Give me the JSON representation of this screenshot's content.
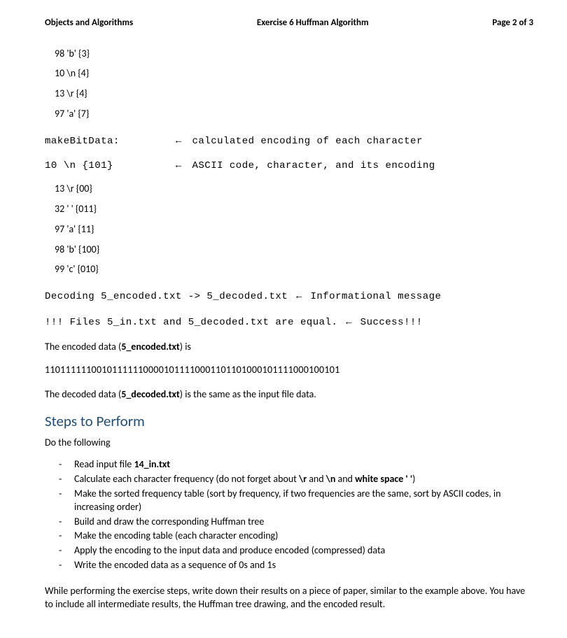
{
  "header": {
    "left": "Objects and Algorithms",
    "center": "Exercise 6 Huffman Algorithm",
    "right": "Page 2 of 3"
  },
  "freq": {
    "l1": "98 'b' {3}",
    "l2": "10 \\n {4}",
    "l3": "13 \\r {4}",
    "l4": "97 'a' {7}"
  },
  "makebit": {
    "label": "makeBitData:",
    "arrow": "←",
    "note": "calculated encoding of each character"
  },
  "encrow": {
    "left": "10 \\n {101}",
    "arrow": "←",
    "note": "ASCII code, character, and its encoding"
  },
  "enc": {
    "l1": "13 \\r {00}",
    "l2": "32 ' ' {011}",
    "l3": "97 'a' {11}",
    "l4": "98 'b' {100}",
    "l5": "99 'c' {010}"
  },
  "decode_line": {
    "text": "Decoding 5_encoded.txt -> 5_decoded.txt ",
    "arrow": "←",
    "note": " Informational message"
  },
  "equal_line": {
    "text": "!!! Files 5_in.txt and 5_decoded.txt are equal. ",
    "arrow": "←",
    "note": " Success!!!"
  },
  "encoded_intro": {
    "pre": "The encoded data (",
    "bold": "5_encoded.txt",
    "post": ") is"
  },
  "binary": "110111111001011111100001011110001101101000101111000100101",
  "decoded_intro": {
    "pre": "The decoded data (",
    "bold": "5_decoded.txt",
    "post": ") is the same as the input file data."
  },
  "section_heading": "Steps to Perform",
  "do_following": "Do the following",
  "steps": {
    "s1": {
      "pre": "Read input file ",
      "bold": "14_in.txt"
    },
    "s2": {
      "pre": "Calculate each character frequency (do not forget about ",
      "b1": "\\r",
      "mid1": " and ",
      "b2": "\\n",
      "mid2": " and ",
      "b3": "white space ' '",
      "post": ")"
    },
    "s3": "Make the sorted frequency table (sort by frequency, if two frequencies are the same, sort by ASCII codes, in increasing order)",
    "s4": "Build and draw the corresponding Huffman tree",
    "s5": "Make the encoding table (each character encoding)",
    "s6": "Apply the encoding to the input data and produce encoded (compressed) data",
    "s7": "Write the encoded data as a sequence of 0s and 1s"
  },
  "closing": "While performing the exercise steps, write down their results on a piece of paper, similar to the example above. You have to include all intermediate results, the Huffman tree drawing, and the encoded result."
}
